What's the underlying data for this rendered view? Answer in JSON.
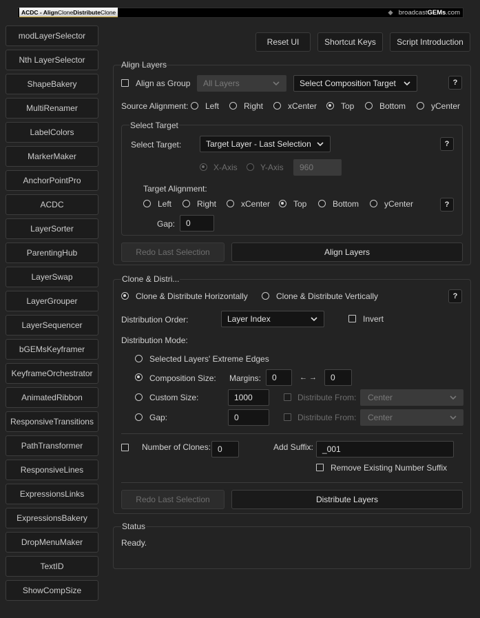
{
  "banner": {
    "left_bold": "ACDC - Align",
    "left_mid": "Clone",
    "left_bold2": "Distribute",
    "left_end": "Clone",
    "brand_light": "broadcast",
    "brand_bold": "GEMs",
    "brand_suffix": ".com"
  },
  "sidebar": {
    "items": [
      {
        "label": "modLayerSelector"
      },
      {
        "label": "Nth LayerSelector"
      },
      {
        "label": "ShapeBakery"
      },
      {
        "label": "MultiRenamer"
      },
      {
        "label": "LabelColors"
      },
      {
        "label": "MarkerMaker"
      },
      {
        "label": "AnchorPointPro"
      },
      {
        "label": "ACDC"
      },
      {
        "label": "LayerSorter"
      },
      {
        "label": "ParentingHub"
      },
      {
        "label": "LayerSwap"
      },
      {
        "label": "LayerGrouper"
      },
      {
        "label": "LayerSequencer"
      },
      {
        "label": "bGEMsKeyframer"
      },
      {
        "label": "KeyframeOrchestrator"
      },
      {
        "label": "AnimatedRibbon"
      },
      {
        "label": "ResponsiveTransitions"
      },
      {
        "label": "PathTransformer"
      },
      {
        "label": "ResponsiveLines"
      },
      {
        "label": "ExpressionsLinks"
      },
      {
        "label": "ExpressionsBakery"
      },
      {
        "label": "DropMenuMaker"
      },
      {
        "label": "TextID"
      },
      {
        "label": "ShowCompSize"
      }
    ]
  },
  "toolbar": {
    "reset": "Reset UI",
    "shortcut": "Shortcut Keys",
    "intro": "Script Introduction"
  },
  "align": {
    "title": "Align Layers",
    "as_group": "Align as Group",
    "all_layers": "All Layers",
    "comp_target": "Select Composition Target",
    "help": "?",
    "source_label": "Source Alignment:",
    "source_options": [
      "Left",
      "Right",
      "xCenter",
      "Top",
      "Bottom",
      "yCenter"
    ],
    "source_selected": "Top",
    "select_target_group": "Select Target",
    "select_target_label": "Select Target:",
    "select_target_value": "Target Layer - Last Selection",
    "x_axis": "X-Axis",
    "y_axis": "Y-Axis",
    "axis_value": "960",
    "target_alignment_label": "Target Alignment:",
    "target_options": [
      "Left",
      "Right",
      "xCenter",
      "Top",
      "Bottom",
      "yCenter"
    ],
    "target_selected": "Top",
    "gap_label": "Gap:",
    "gap_value": "0",
    "redo": "Redo Last Selection",
    "align_btn": "Align Layers"
  },
  "clone": {
    "title": "Clone & Distri...",
    "horiz": "Clone & Distribute Horizontally",
    "vert": "Clone & Distribute Vertically",
    "help": "?",
    "order_label": "Distribution Order:",
    "order_value": "Layer Index",
    "invert": "Invert",
    "mode_label": "Distribution Mode:",
    "mode_extreme": "Selected Layers' Extreme Edges",
    "mode_comp": "Composition Size:",
    "margins_label": "Margins:",
    "margin_left": "0",
    "margin_right": "0",
    "arrows": "← →",
    "mode_custom": "Custom Size:",
    "custom_value": "1000",
    "dist_from": "Distribute From:",
    "dist_from_value": "Center",
    "mode_gap": "Gap:",
    "gap_value": "0",
    "dist_from2": "Distribute From:",
    "dist_from_value2": "Center",
    "num_clones": "Number of Clones:",
    "num_clones_value": "0",
    "add_suffix": "Add Suffix:",
    "suffix_value": "_001",
    "remove_suffix": "Remove Existing Number Suffix",
    "redo": "Redo Last Selection",
    "distribute_btn": "Distribute Layers"
  },
  "status": {
    "title": "Status",
    "text": "Ready."
  }
}
